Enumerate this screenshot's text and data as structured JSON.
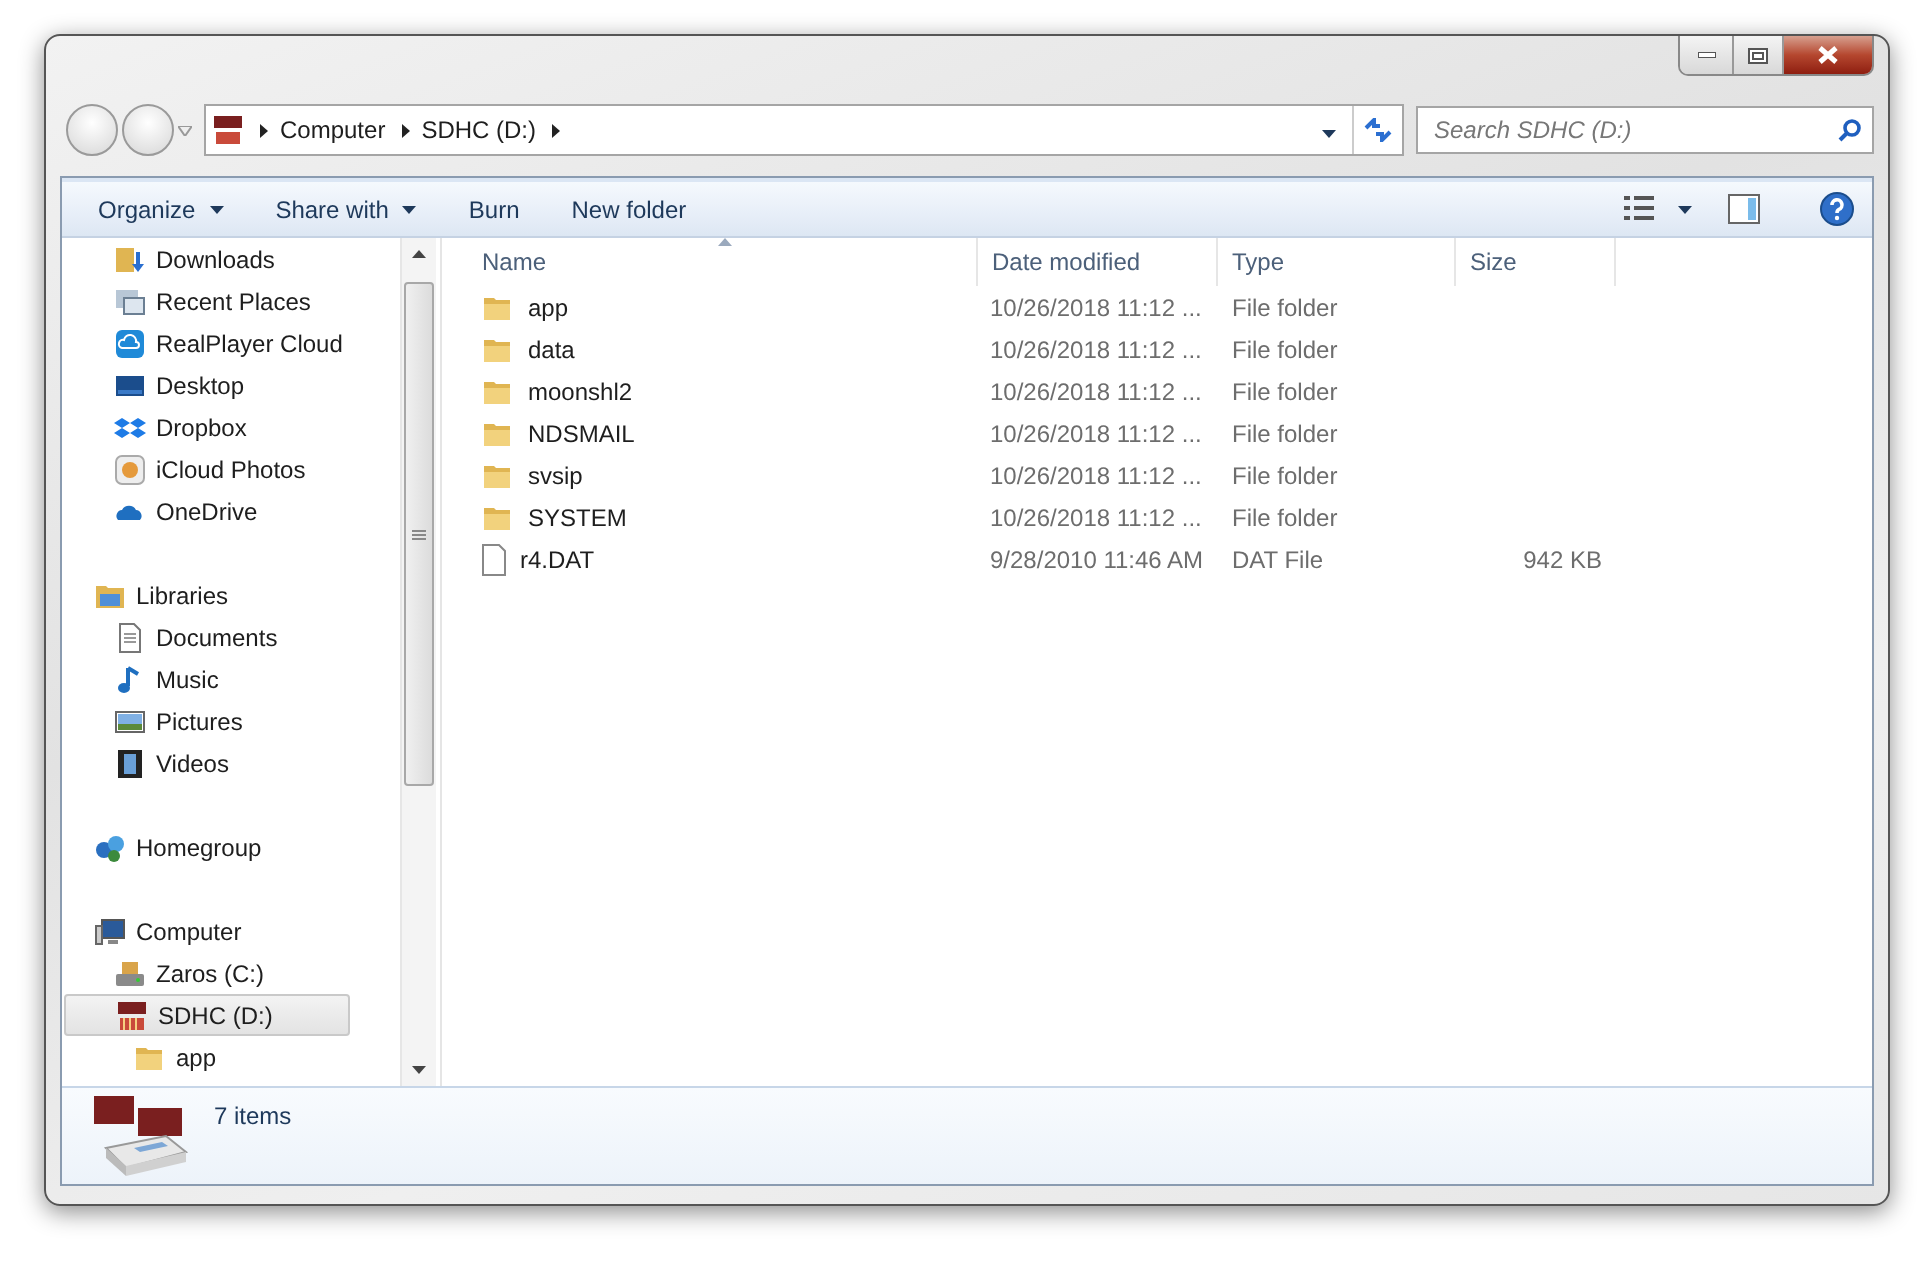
{
  "address": {
    "crumbs": [
      "Computer",
      "SDHC (D:)"
    ],
    "search_placeholder": "Search SDHC (D:)"
  },
  "toolbar": {
    "buttons": [
      {
        "label": "Organize",
        "dropdown": true
      },
      {
        "label": "Share with",
        "dropdown": true
      },
      {
        "label": "Burn",
        "dropdown": false
      },
      {
        "label": "New folder",
        "dropdown": false
      }
    ]
  },
  "sidebar": {
    "favorites": [
      {
        "label": "Downloads",
        "kind": "downloads",
        "selected": false
      },
      {
        "label": "Recent Places",
        "kind": "recent",
        "selected": false
      },
      {
        "label": "RealPlayer Cloud",
        "kind": "cloud-app",
        "selected": false
      },
      {
        "label": "Desktop",
        "kind": "desktop",
        "selected": false
      },
      {
        "label": "Dropbox",
        "kind": "dropbox",
        "selected": false
      },
      {
        "label": "iCloud Photos",
        "kind": "photos",
        "selected": false
      },
      {
        "label": "OneDrive",
        "kind": "onedrive",
        "selected": false
      }
    ],
    "groups": [
      {
        "label": "Libraries",
        "kind": "library",
        "selected": false,
        "children": [
          {
            "label": "Documents",
            "kind": "document",
            "selected": false
          },
          {
            "label": "Music",
            "kind": "music",
            "selected": false
          },
          {
            "label": "Pictures",
            "kind": "pictures",
            "selected": false
          },
          {
            "label": "Videos",
            "kind": "videos",
            "selected": false
          }
        ]
      },
      {
        "label": "Homegroup",
        "kind": "homegroup",
        "selected": false
      },
      {
        "label": "Computer",
        "kind": "computer",
        "selected": false,
        "children": [
          {
            "label": "Zaros (C:)",
            "kind": "drive",
            "selected": false
          },
          {
            "label": "SDHC (D:)",
            "kind": "sdcard",
            "selected": true,
            "children": [
              {
                "label": "app",
                "kind": "folder",
                "selected": false
              }
            ]
          }
        ]
      }
    ]
  },
  "table": {
    "columns": [
      {
        "label": "Name",
        "sorted": true
      },
      {
        "label": "Date modified",
        "sorted": false
      },
      {
        "label": "Type",
        "sorted": false
      },
      {
        "label": "Size",
        "sorted": false
      }
    ],
    "rows": [
      {
        "kind": "folder",
        "name": "app",
        "date": "10/26/2018 11:12 ...",
        "type": "File folder"
      },
      {
        "kind": "folder",
        "name": "data",
        "date": "10/26/2018 11:12 ...",
        "type": "File folder"
      },
      {
        "kind": "folder",
        "name": "moonshl2",
        "date": "10/26/2018 11:12 ...",
        "type": "File folder"
      },
      {
        "kind": "folder",
        "name": "NDSMAIL",
        "date": "10/26/2018 11:12 ...",
        "type": "File folder"
      },
      {
        "kind": "folder",
        "name": "svsip",
        "date": "10/26/2018 11:12 ...",
        "type": "File folder"
      },
      {
        "kind": "folder",
        "name": "SYSTEM",
        "date": "10/26/2018 11:12 ...",
        "type": "File folder"
      },
      {
        "kind": "file",
        "name": "r4.DAT",
        "date": "9/28/2010 11:46 AM",
        "type": "DAT File",
        "size": "942 KB"
      }
    ]
  },
  "status": {
    "count": "7 items"
  }
}
